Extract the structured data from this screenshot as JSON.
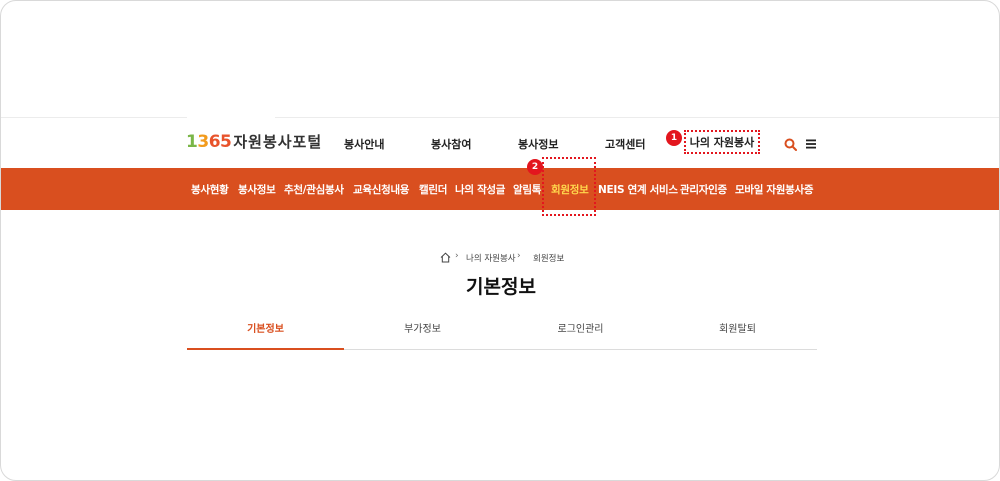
{
  "logo": {
    "num1": "1",
    "num2": "3",
    "num3": "65",
    "text": "자원봉사포털"
  },
  "gnb": {
    "items": [
      "봉사안내",
      "봉사참여",
      "봉사정보",
      "고객센터"
    ],
    "my_volunteer": "나의 자원봉사",
    "search_icon": "search-icon",
    "menu_icon": "hamburger-menu-icon",
    "accent": "#d94f1f"
  },
  "badges": {
    "one": "1",
    "two": "2"
  },
  "submenu": {
    "items": [
      "봉사현황",
      "봉사정보",
      "추천/관심봉사",
      "교육신청내용",
      "캘린더",
      "나의 작성글",
      "알림톡",
      "회원정보",
      "NEIS 연계 서비스",
      "관리자인증",
      "모바일 자원봉사증"
    ],
    "active": "회원정보"
  },
  "breadcrumb": {
    "level1": "나의 자원봉사",
    "level2": "회원정보"
  },
  "page": {
    "title": "기본정보"
  },
  "tabs": [
    "기본정보",
    "부가정보",
    "로그인관리",
    "회원탈퇴"
  ]
}
